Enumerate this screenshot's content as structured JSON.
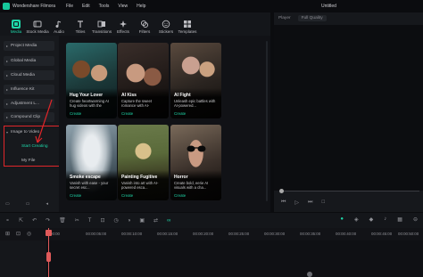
{
  "app": {
    "title": "Wondershare Filmora",
    "doc_title": "Untitled"
  },
  "menu": [
    "File",
    "Edit",
    "Tools",
    "View",
    "Help"
  ],
  "toolbar": [
    {
      "label": "Media",
      "icon": "media-icon",
      "active": true
    },
    {
      "label": "Stock Media",
      "icon": "stock-media-icon",
      "active": false
    },
    {
      "label": "Audio",
      "icon": "audio-icon",
      "active": false
    },
    {
      "label": "Titles",
      "icon": "titles-icon",
      "active": false
    },
    {
      "label": "Transitions",
      "icon": "transitions-icon",
      "active": false
    },
    {
      "label": "Effects",
      "icon": "effects-icon",
      "active": false
    },
    {
      "label": "Filters",
      "icon": "filters-icon",
      "active": false
    },
    {
      "label": "Stickers",
      "icon": "stickers-icon",
      "active": false
    },
    {
      "label": "Templates",
      "icon": "templates-icon",
      "active": false
    }
  ],
  "sidebar": {
    "items": [
      "Project Media",
      "Global Media",
      "Cloud Media",
      "Influence Kit",
      "Adjustment L...",
      "Compound Clip"
    ],
    "expanded": "Image to Video",
    "sub_items": [
      "Start Creating",
      "My File"
    ],
    "accent": "#1ed6a8",
    "highlight_color": "#e0262a"
  },
  "cards": [
    {
      "title": "Hug Your Lover",
      "desc": "Create heartwarming AI hug videos with the",
      "cta": "Create"
    },
    {
      "title": "AI Kiss",
      "desc": "Capture the sweet romance with AI-",
      "cta": "Create"
    },
    {
      "title": "AI Fight",
      "desc": "Unleash epic battles with AI-powered...",
      "cta": "Create"
    },
    {
      "title": "Smoke escape",
      "desc": "Vanish with ease - your secret esc...",
      "cta": "Create"
    },
    {
      "title": "Painting Fugitive",
      "desc": "Vanish into art with AI-powered esca...",
      "cta": "Create"
    },
    {
      "title": "Horror",
      "desc": "Create bold, eerie AI visuals with a cha...",
      "cta": "Create"
    }
  ],
  "player": {
    "label": "Player",
    "quality": "Full Quality"
  },
  "timeline": {
    "ruler": [
      "00:00",
      "00:00:05:00",
      "00:00:10:00",
      "00:00:15:00",
      "00:00:20:00",
      "00:00:25:00",
      "00:00:30:00",
      "00:00:35:00",
      "00:00:40:00",
      "00:00:45:00",
      "00:00:50:00"
    ]
  }
}
